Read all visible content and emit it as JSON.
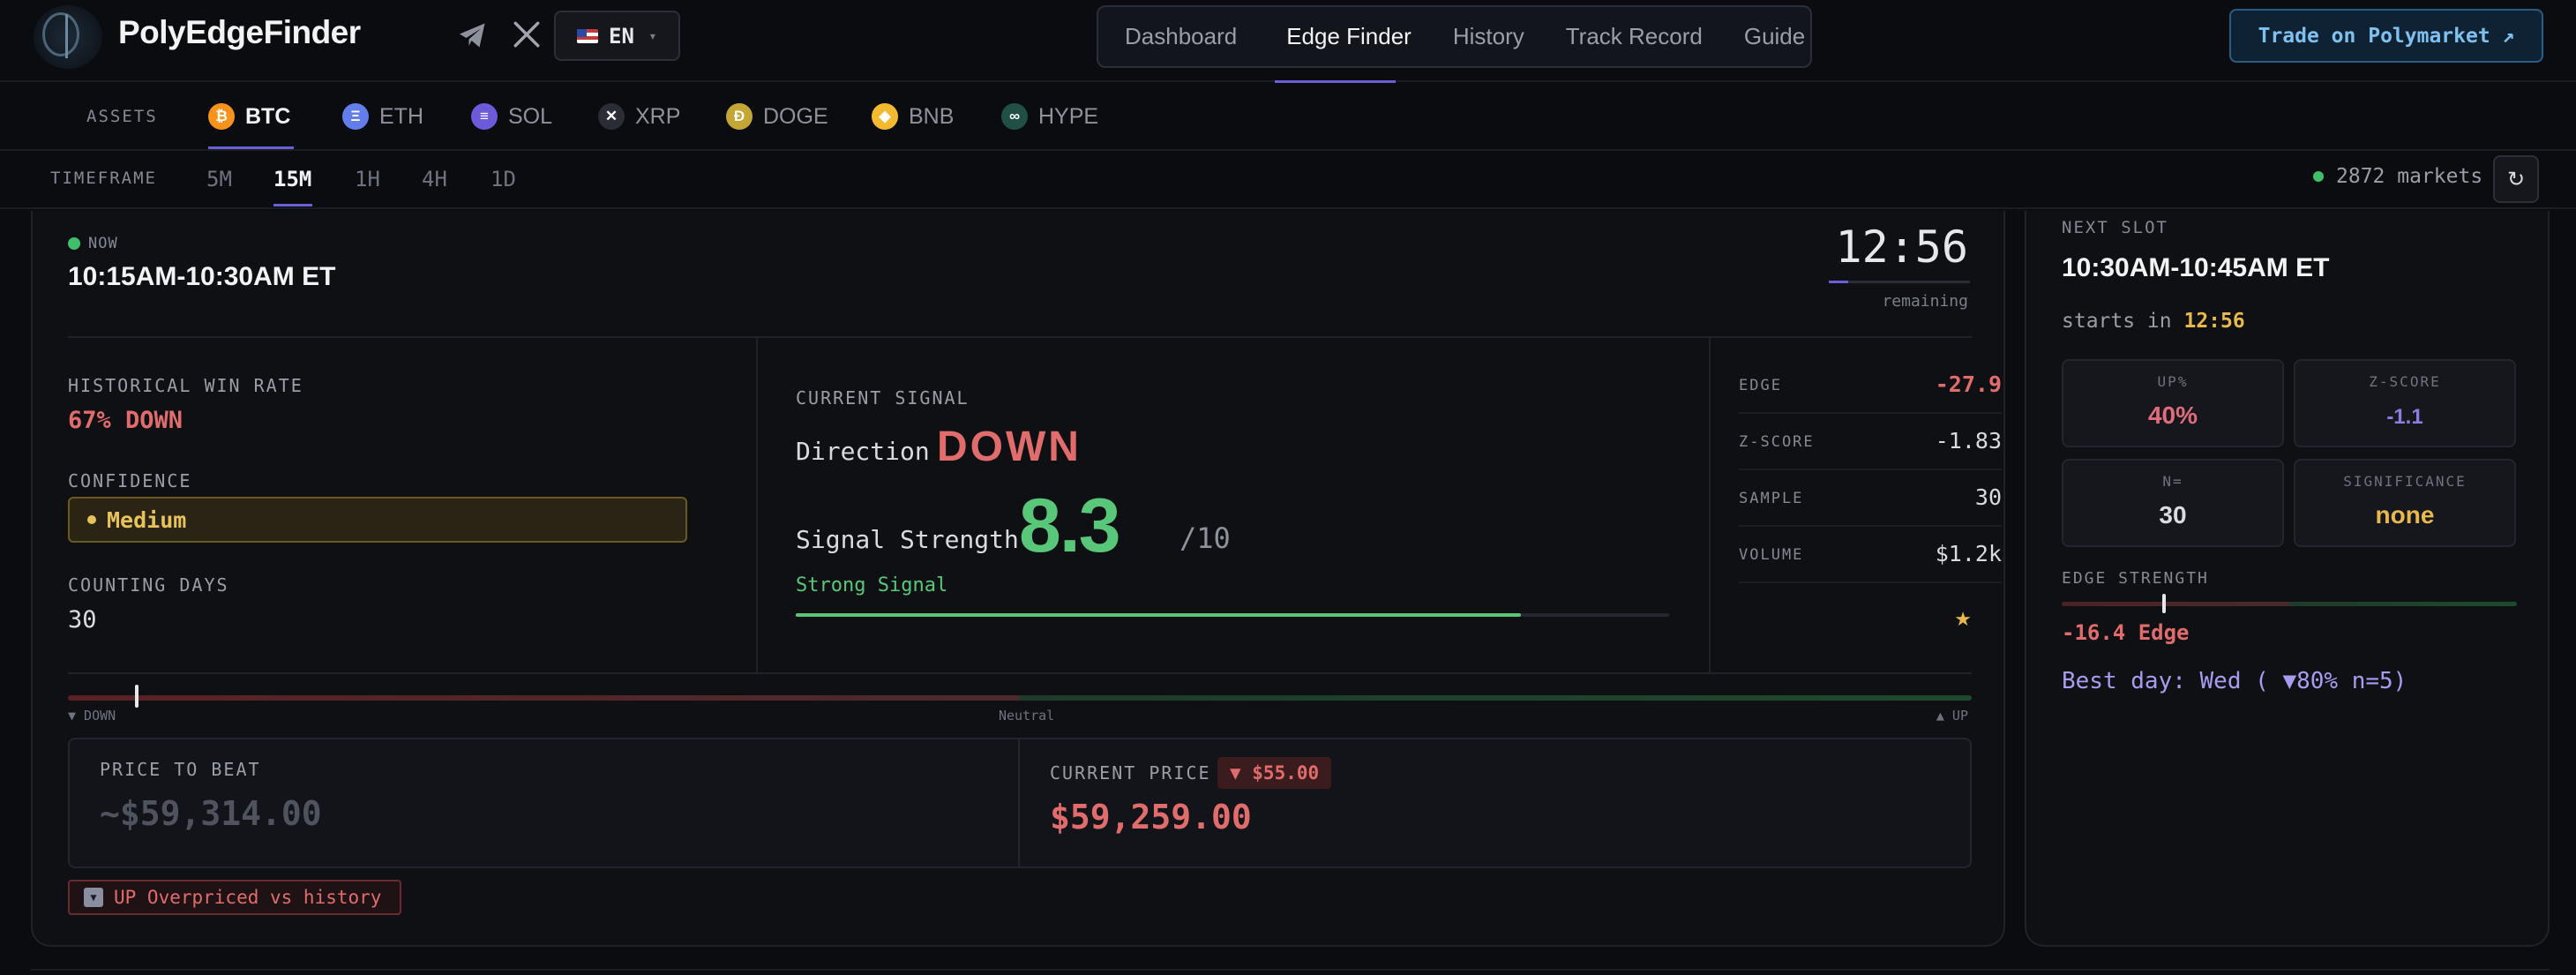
{
  "brand": "PolyEdgeFinder",
  "lang": {
    "label": "EN"
  },
  "nav": {
    "items": [
      {
        "label": "Dashboard",
        "active": false
      },
      {
        "label": "Edge Finder",
        "active": true
      },
      {
        "label": "History",
        "active": false
      },
      {
        "label": "Track Record",
        "active": false
      },
      {
        "label": "Guide",
        "active": false
      }
    ]
  },
  "trade_button": "Trade on Polymarket ↗",
  "assets": {
    "label": "ASSETS",
    "items": [
      {
        "symbol": "BTC",
        "color": "#f7931a",
        "glyph": "₿",
        "active": true
      },
      {
        "symbol": "ETH",
        "color": "#627eea",
        "glyph": "Ξ",
        "active": false
      },
      {
        "symbol": "SOL",
        "color": "#6b5bd9",
        "glyph": "≡",
        "active": false
      },
      {
        "symbol": "XRP",
        "color": "#2a2d35",
        "glyph": "✕",
        "active": false
      },
      {
        "symbol": "DOGE",
        "color": "#c3a634",
        "glyph": "Ð",
        "active": false
      },
      {
        "symbol": "BNB",
        "color": "#f3ba2f",
        "glyph": "◆",
        "active": false
      },
      {
        "symbol": "HYPE",
        "color": "#1f4f45",
        "glyph": "∞",
        "active": false
      }
    ]
  },
  "timeframe": {
    "label": "TIMEFRAME",
    "items": [
      {
        "label": "5M",
        "active": false
      },
      {
        "label": "15M",
        "active": true
      },
      {
        "label": "1H",
        "active": false
      },
      {
        "label": "4H",
        "active": false
      },
      {
        "label": "1D",
        "active": false
      }
    ],
    "markets": "2872 markets",
    "refresh": "↻"
  },
  "current": {
    "now_label": "NOW",
    "slot": "10:15AM-10:30AM ET",
    "timer": "12:56",
    "remaining_label": "remaining",
    "remaining_fraction": 0.14,
    "historical_win_rate_label": "HISTORICAL WIN RATE",
    "historical_win_rate": "67% DOWN",
    "confidence_label": "CONFIDENCE",
    "confidence": "Medium",
    "counting_days_label": "COUNTING DAYS",
    "counting_days": "30",
    "signal_label": "CURRENT SIGNAL",
    "direction_label": "Direction",
    "direction": "DOWN",
    "strength_label": "Signal Strength",
    "strength": "8.3",
    "strength_max": "/10",
    "strength_fraction": 0.83,
    "strength_desc": "Strong Signal",
    "stats": [
      {
        "key": "EDGE",
        "value": "-27.9",
        "red": true
      },
      {
        "key": "Z-SCORE",
        "value": "-1.83",
        "red": false
      },
      {
        "key": "SAMPLE",
        "value": "30",
        "red": false
      },
      {
        "key": "VOLUME",
        "value": "$1.2k",
        "red": false
      }
    ],
    "star": "★",
    "gauge": {
      "down": "▼ DOWN",
      "neutral": "Neutral",
      "up": "▲ UP",
      "position": 0.035
    },
    "price_to_beat_label": "PRICE TO BEAT",
    "price_to_beat": "~$59,314.00",
    "current_price_label": "CURRENT PRICE",
    "current_price_delta": "▼ $55.00",
    "current_price": "$59,259.00",
    "overpriced": "UP Overpriced vs history",
    "overpriced_icon": "▼"
  },
  "next": {
    "label": "NEXT SLOT",
    "slot": "10:30AM-10:45AM ET",
    "starts_prefix": "starts in",
    "starts_in": "12:56",
    "metrics": [
      {
        "key": "UP%",
        "value": "40%",
        "color": "#e06c7c"
      },
      {
        "key": "Z-SCORE",
        "value": "-1.1",
        "color": "#8a7fe0"
      },
      {
        "key": "N=",
        "value": "30",
        "color": "#d9dbe0"
      },
      {
        "key": "SIGNIFICANCE",
        "value": "none",
        "color": "#e8b84a"
      }
    ],
    "edge_strength_label": "EDGE STRENGTH",
    "edge_strength": "-16.4 Edge",
    "edge_position": 0.22,
    "best_day": "Best day: Wed ( ▼80% n=5)"
  }
}
